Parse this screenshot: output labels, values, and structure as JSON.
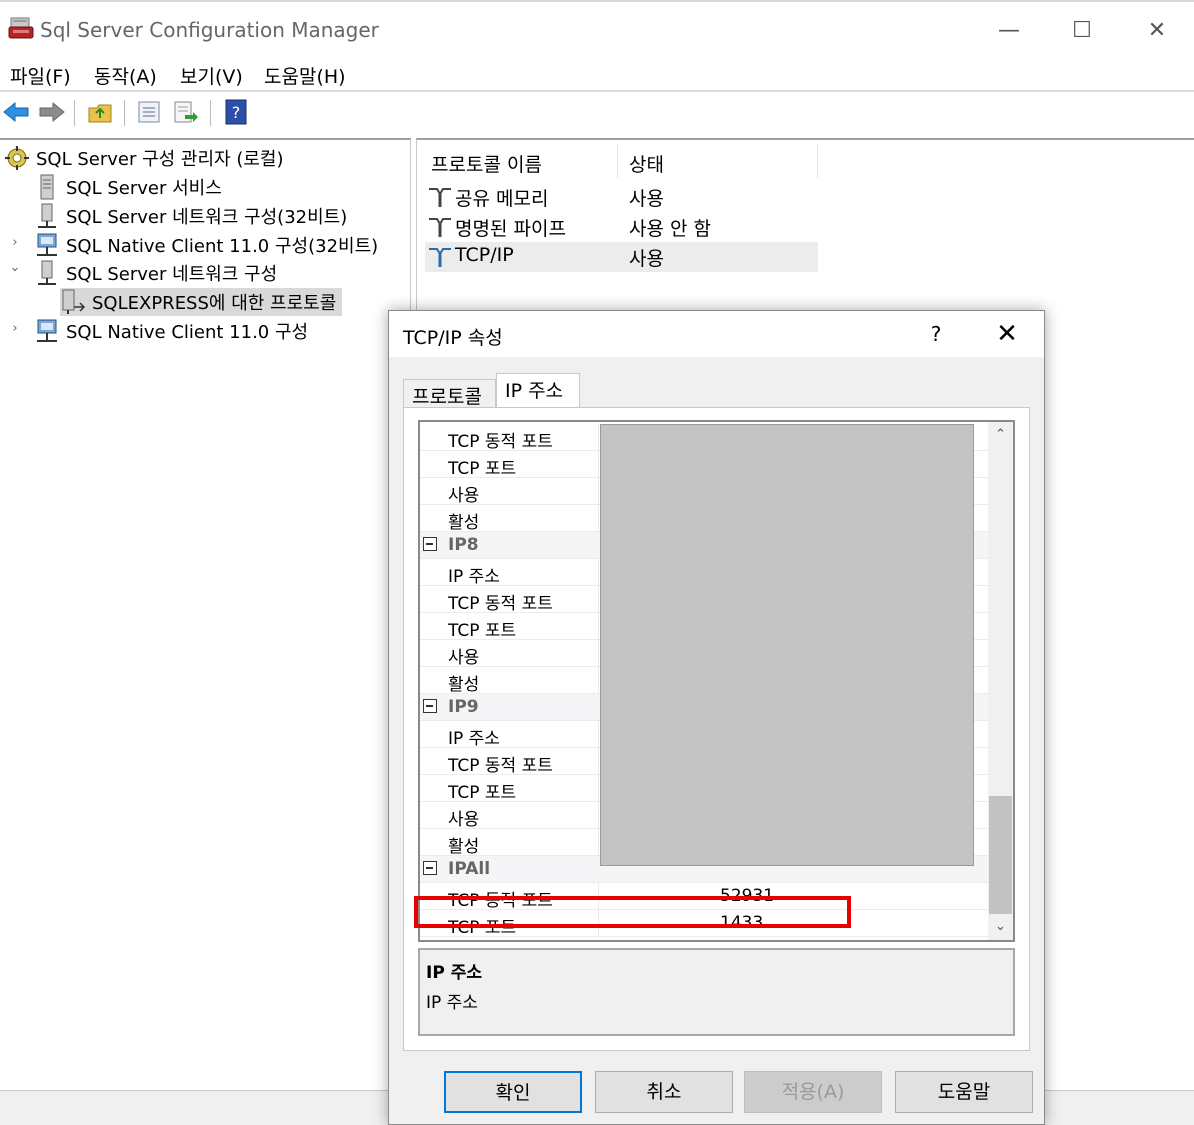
{
  "window": {
    "title": "Sql Server Configuration Manager",
    "minimize": "—",
    "maximize": "☐",
    "close": "✕"
  },
  "menu": [
    "파일(F)",
    "동작(A)",
    "보기(V)",
    "도움말(H)"
  ],
  "toolbar": {
    "buttons": [
      "back-arrow-icon",
      "forward-arrow-icon",
      "up-folder-icon",
      "properties-icon",
      "export-list-icon",
      "help-icon"
    ],
    "help_glyph": "?"
  },
  "tree": {
    "root": "SQL Server 구성 관리자 (로컬)",
    "items": [
      "SQL Server 서비스",
      "SQL Server 네트워크 구성(32비트)",
      "SQL Native Client 11.0 구성(32비트)",
      "SQL Server 네트워크 구성",
      "SQLEXPRESS에 대한 프로토콜",
      "SQL Native Client 11.0 구성"
    ],
    "expand_collapsed": "›",
    "expand_open": "⌄"
  },
  "list": {
    "col_name": "프로토콜 이름",
    "col_status": "상태",
    "rows": [
      {
        "name": "공유 메모리",
        "status": "사용"
      },
      {
        "name": "명명된 파이프",
        "status": "사용 안 함"
      },
      {
        "name": "TCP/IP",
        "status": "사용"
      }
    ]
  },
  "dialog": {
    "title": "TCP/IP 속성",
    "help": "?",
    "close": "✕",
    "tabs": [
      "프로토콜",
      "IP 주소"
    ],
    "grid": [
      {
        "key": "TCP 동적 포트",
        "value": ""
      },
      {
        "key": "TCP 포트",
        "value": ""
      },
      {
        "key": "사용",
        "value": ""
      },
      {
        "key": "활성",
        "value": ""
      },
      {
        "key": "IP8",
        "category": true
      },
      {
        "key": "IP 주소",
        "value": ""
      },
      {
        "key": "TCP 동적 포트",
        "value": ""
      },
      {
        "key": "TCP 포트",
        "value": ""
      },
      {
        "key": "사용",
        "value": ""
      },
      {
        "key": "활성",
        "value": ""
      },
      {
        "key": "IP9",
        "category": true
      },
      {
        "key": "IP 주소",
        "value": ""
      },
      {
        "key": "TCP 동적 포트",
        "value": ""
      },
      {
        "key": "TCP 포트",
        "value": ""
      },
      {
        "key": "사용",
        "value": ""
      },
      {
        "key": "활성",
        "value": ""
      },
      {
        "key": "IPAll",
        "category": true
      },
      {
        "key": "TCP 동적 포트",
        "value": "52931"
      },
      {
        "key": "TCP 포트",
        "value": "1433"
      }
    ],
    "scroll_up": "⌃",
    "scroll_down": "⌄",
    "description_title": "IP 주소",
    "description_text": "IP 주소",
    "buttons": {
      "ok": "확인",
      "cancel": "취소",
      "apply": "적용(A)",
      "help": "도움말"
    }
  },
  "colors": {
    "highlight_border": "#e80000",
    "redaction": "#c3c3c3",
    "accent": "#0078d7"
  }
}
